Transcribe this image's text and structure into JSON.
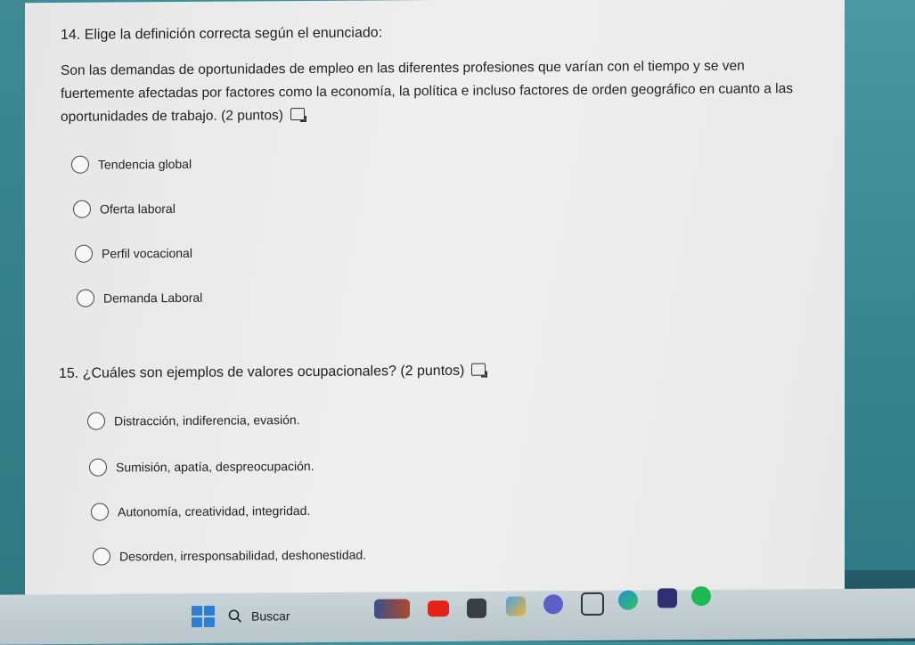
{
  "q14": {
    "title": "14. Elige la definición correcta según el enunciado:",
    "body": "Son las demandas de oportunidades de empleo en las diferentes profesiones que varían con el tiempo y se ven fuertemente afectadas por factores como la economía, la política e incluso factores de orden geográfico en cuanto a las oportunidades de trabajo. (2 puntos)",
    "options": [
      "Tendencia global",
      "Oferta laboral",
      "Perfil vocacional",
      "Demanda Laboral"
    ]
  },
  "q15": {
    "title": "15. ¿Cuáles son ejemplos de valores ocupacionales? (2 puntos)",
    "options": [
      "Distracción, indiferencia, evasión.",
      "Sumisión, apatía, despreocupación.",
      "Autonomía, creatividad, integridad.",
      "Desorden, irresponsabilidad, deshonestidad."
    ]
  },
  "taskbar": {
    "search_label": "Buscar",
    "icons": [
      "windows-start-icon",
      "search-icon",
      "widget-icon",
      "youtube-icon",
      "calculator-icon",
      "paint-icon",
      "teams-icon",
      "steam-icon",
      "edge-icon",
      "xbox-icon",
      "spotify-icon"
    ]
  },
  "colors": {
    "panel_bg": "#eaeaea",
    "desktop_bg": "#2f7f8c",
    "taskbar_bg": "#c2cdd1",
    "start_blue": "#2b7fd6"
  }
}
